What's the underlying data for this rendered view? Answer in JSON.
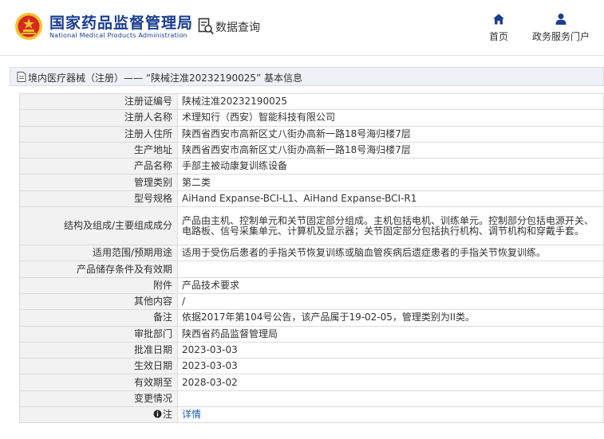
{
  "header": {
    "logo_cn": "国家药品监督管理局",
    "logo_en": "National Medical Products Administration",
    "query_label": "数据查询",
    "nav_home": "首页",
    "nav_portal": "政务服务门户"
  },
  "breadcrumb": "境内医疗器械（注册）—— “陕械注准20232190025” 基本信息",
  "rows": [
    {
      "key": "注册证编号",
      "value": "陕械注准20232190025"
    },
    {
      "key": "注册人名称",
      "value": "术理知行（西安）智能科技有限公司"
    },
    {
      "key": "注册人住所",
      "value": "陕西省西安市高新区丈八街办高新一路18号海归楼7层"
    },
    {
      "key": "生产地址",
      "value": "陕西省西安市高新区丈八街办高新一路18号海归楼7层"
    },
    {
      "key": "产品名称",
      "value": "手部主被动康复训练设备"
    },
    {
      "key": "管理类别",
      "value": "第二类"
    },
    {
      "key": "型号规格",
      "value": "AiHand Expanse-BCI-L1、AiHand Expanse-BCI-R1"
    },
    {
      "key": "结构及组成/主要组成成分",
      "value": "产品由主机、控制单元和关节固定部分组成。主机包括电机、训练单元。控制部分包括电源开关、电路板、信号采集单元、计算机及显示器；关节固定部分包括执行机构、调节机构和穿戴手套。"
    },
    {
      "key": "适用范围/预期用途",
      "value": "适用于受伤后患者的手指关节恢复训练或脑血管疾病后遗症患者的手指关节恢复训练。"
    },
    {
      "key": "产品储存条件及有效期",
      "value": ""
    },
    {
      "key": "附件",
      "value": "产品技术要求"
    },
    {
      "key": "其他内容",
      "value": "/"
    },
    {
      "key": "备注",
      "value": "依据2017年第104号公告，该产品属于19-02-05，管理类别为II类。"
    },
    {
      "key": "审批部门",
      "value": "陕西省药品监督管理局"
    },
    {
      "key": "批准日期",
      "value": "2023-03-03"
    },
    {
      "key": "生效日期",
      "value": "2023-03-03"
    },
    {
      "key": "有效期至",
      "value": "2028-03-02"
    },
    {
      "key": "变更情况",
      "value": ""
    },
    {
      "key": "注",
      "value": "详情"
    }
  ],
  "colors": {
    "brand": "#1a3d8f",
    "link": "#1a5bb5",
    "emblem_red": "#d62a1f",
    "emblem_gold": "#f2c230"
  }
}
